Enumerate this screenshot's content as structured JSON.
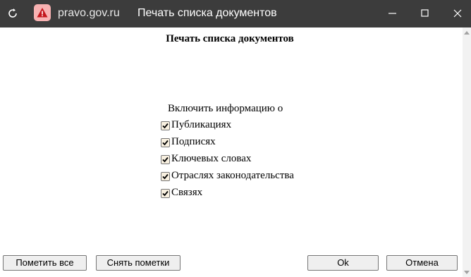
{
  "window": {
    "domain": "pravo.gov.ru",
    "title": "Печать списка документов"
  },
  "dialog": {
    "heading": "Печать списка документов",
    "include_label": "Включить информацию о",
    "options": [
      {
        "label": "Публикациях",
        "checked": true
      },
      {
        "label": "Подписях",
        "checked": true
      },
      {
        "label": "Ключевых словах",
        "checked": true
      },
      {
        "label": "Отраслях законодательства",
        "checked": true
      },
      {
        "label": "Связях",
        "checked": true
      }
    ]
  },
  "buttons": {
    "mark_all": "Пометить все",
    "clear_marks": "Снять пометки",
    "ok": "Ok",
    "cancel": "Отмена"
  },
  "colors": {
    "titlebar": "#3c3c3c",
    "warning_badge": "#f8b2b2",
    "warning_icon": "#c4161c",
    "checkbox_fill": "#f8f0e0"
  },
  "icons": [
    "reload-icon",
    "warning-icon",
    "minimize-icon",
    "maximize-icon",
    "close-icon",
    "check-icon"
  ]
}
